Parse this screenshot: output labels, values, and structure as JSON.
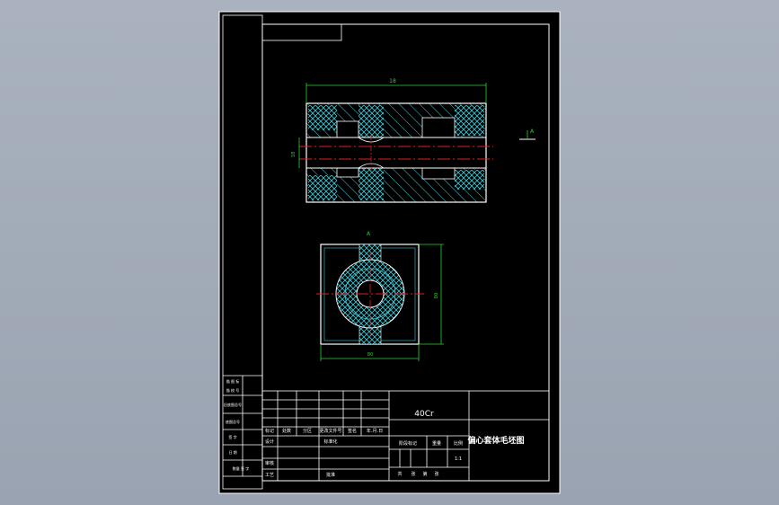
{
  "drawing": {
    "dimensions": {
      "overall_length": "18",
      "bore_diameter": "18",
      "section_label": "A",
      "square_width": "80",
      "square_height": "80"
    },
    "section_marker": "A"
  },
  "title_block": {
    "material": "40Cr",
    "part_name": "偏心套体毛坯图",
    "scale": "1:1",
    "grid": {
      "r1": [
        "标记",
        "处数",
        "分区",
        "更改文件号",
        "签名",
        "年.月.日"
      ],
      "r2": [
        "设计",
        "",
        "标准化",
        "",
        "阶段标记",
        "重量",
        "比例"
      ],
      "r3": [
        "审核",
        ""
      ],
      "r4": [
        "工艺",
        "",
        "批准",
        "",
        "共",
        "张",
        "第",
        "张"
      ]
    },
    "side_labels": [
      "描 图 标",
      "描 校 号",
      "旧底图总号",
      "底图总号",
      "签 字",
      "日 期",
      "数量 签 字"
    ]
  },
  "colors": {
    "line_white": "#ffffff",
    "hatch_cyan": "#3fc8d6",
    "dim_green": "#2ed12e",
    "center_red": "#e02020",
    "background": "#000000"
  }
}
